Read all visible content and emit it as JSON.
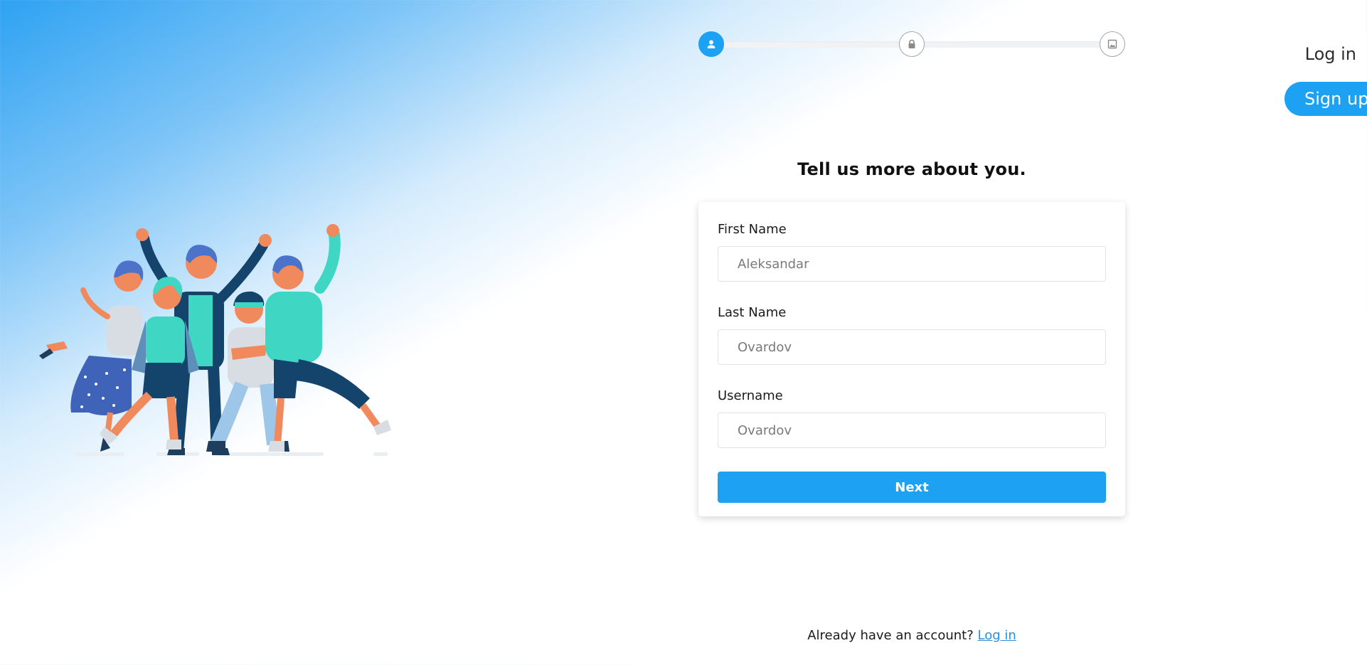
{
  "nav": {
    "login_label": "Log in",
    "signup_label": "Sign up"
  },
  "stepper": {
    "steps": [
      {
        "icon": "user-icon",
        "state": "active"
      },
      {
        "icon": "lock-icon",
        "state": "pending"
      },
      {
        "icon": "image-icon",
        "state": "pending"
      }
    ],
    "accent": "#1da1f2"
  },
  "form": {
    "heading": "Tell us more about you.",
    "fields": [
      {
        "label": "First Name",
        "placeholder": "Aleksandar",
        "value": ""
      },
      {
        "label": "Last Name",
        "placeholder": "Ovardov",
        "value": ""
      },
      {
        "label": "Username",
        "placeholder": "Ovardov",
        "value": ""
      }
    ],
    "submit_label": "Next"
  },
  "footer": {
    "prompt": "Already have an account?",
    "link_label": "Log in"
  },
  "illustration": {
    "icon": "group-of-friends-celebrating-illustration"
  }
}
